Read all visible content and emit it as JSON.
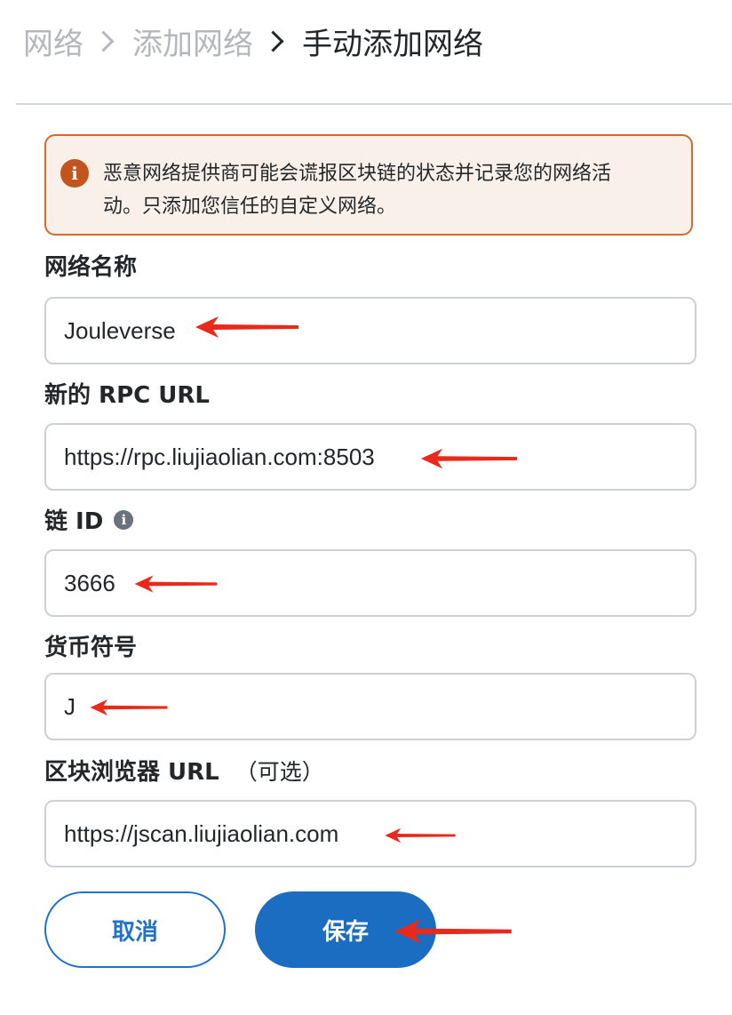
{
  "breadcrumb": {
    "items": [
      "网络",
      "添加网络",
      "手动添加网络"
    ]
  },
  "warning": {
    "icon": "info-circle-icon",
    "line1": "恶意网络提供商可能会谎报区块链的状态并记录您的网络活",
    "line2": "动。只添加您信任的自定义网络。"
  },
  "form": {
    "network_name": {
      "label": "网络名称",
      "value": "Jouleverse"
    },
    "rpc_url": {
      "label": "新的 RPC URL",
      "value": "https://rpc.liujiaolian.com:8503"
    },
    "chain_id": {
      "label": "链 ID",
      "value": "3666",
      "info_icon": "info-icon"
    },
    "currency_symbol": {
      "label": "货币符号",
      "value": "J"
    },
    "explorer_url": {
      "label": "区块浏览器 URL",
      "optional": "（可选）",
      "value": "https://jscan.liujiaolian.com"
    }
  },
  "buttons": {
    "cancel": "取消",
    "save": "保存"
  },
  "colors": {
    "primary": "#1a6dc0",
    "warning_border": "#d66a2a",
    "warning_bg": "#faf0ea",
    "annotation_arrow": "#e8291c"
  }
}
